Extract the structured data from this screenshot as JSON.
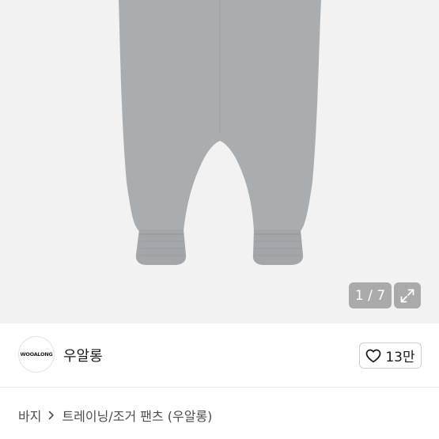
{
  "gallery": {
    "counter": "1 / 7",
    "current": 1,
    "total": 7,
    "background": "#f2f2f2",
    "product_color": "#a9adb0",
    "expand_icon": "expand-arrows-icon"
  },
  "seller": {
    "avatar_text": "WOOALONG",
    "name": "우알롱"
  },
  "like": {
    "count": "13만",
    "icon": "heart-outline-icon"
  },
  "breadcrumb": {
    "items": [
      "바지",
      "트레이닝/조거 팬츠 (우알롱)"
    ],
    "separator_icon": "chevron-right-icon"
  }
}
